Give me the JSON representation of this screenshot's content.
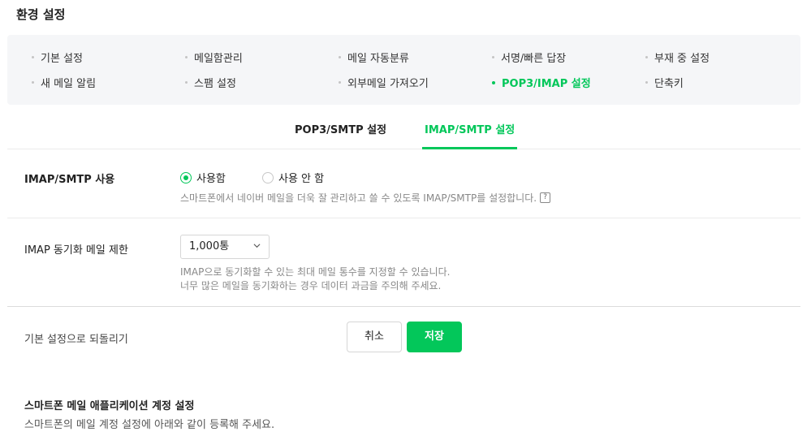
{
  "page": {
    "title": "환경 설정"
  },
  "settings_menu": {
    "row1": [
      "기본 설정",
      "메일함관리",
      "메일 자동분류",
      "서명/빠른 답장",
      "부재 중 설정"
    ],
    "row2": [
      "새 메일 알림",
      "스팸 설정",
      "외부메일 가져오기",
      "POP3/IMAP 설정",
      "단축키"
    ],
    "active": "POP3/IMAP 설정"
  },
  "tabs": [
    {
      "label": "POP3/SMTP 설정",
      "active": false
    },
    {
      "label": "IMAP/SMTP 설정",
      "active": true
    }
  ],
  "imap_use": {
    "label": "IMAP/SMTP 사용",
    "options": [
      {
        "label": "사용함",
        "checked": true
      },
      {
        "label": "사용 안 함",
        "checked": false
      }
    ],
    "help": "스마트폰에서 네이버 메일을 더욱 잘 관리하고 쓸 수 있도록 IMAP/SMTP를 설정합니다.",
    "help_icon": "?"
  },
  "sync_limit": {
    "label": "IMAP 동기화 메일 제한",
    "selected": "1,000통",
    "help_line1": "IMAP으로 동기화할 수 있는 최대 메일 통수를 지정할 수 있습니다.",
    "help_line2": "너무 많은 메일을 동기화하는 경우 데이터 과금을 주의해 주세요."
  },
  "actions": {
    "reset_label": "기본 설정으로 되돌리기",
    "cancel": "취소",
    "save": "저장"
  },
  "smartphone_section": {
    "title": "스마트폰 메일 애플리케이션 계정 설정",
    "desc": "스마트폰의 메일 계정 설정에 아래와 같이 등록해 주세요."
  },
  "colors": {
    "accent": "#03c75a",
    "panel_bg": "#f5f6f8"
  }
}
